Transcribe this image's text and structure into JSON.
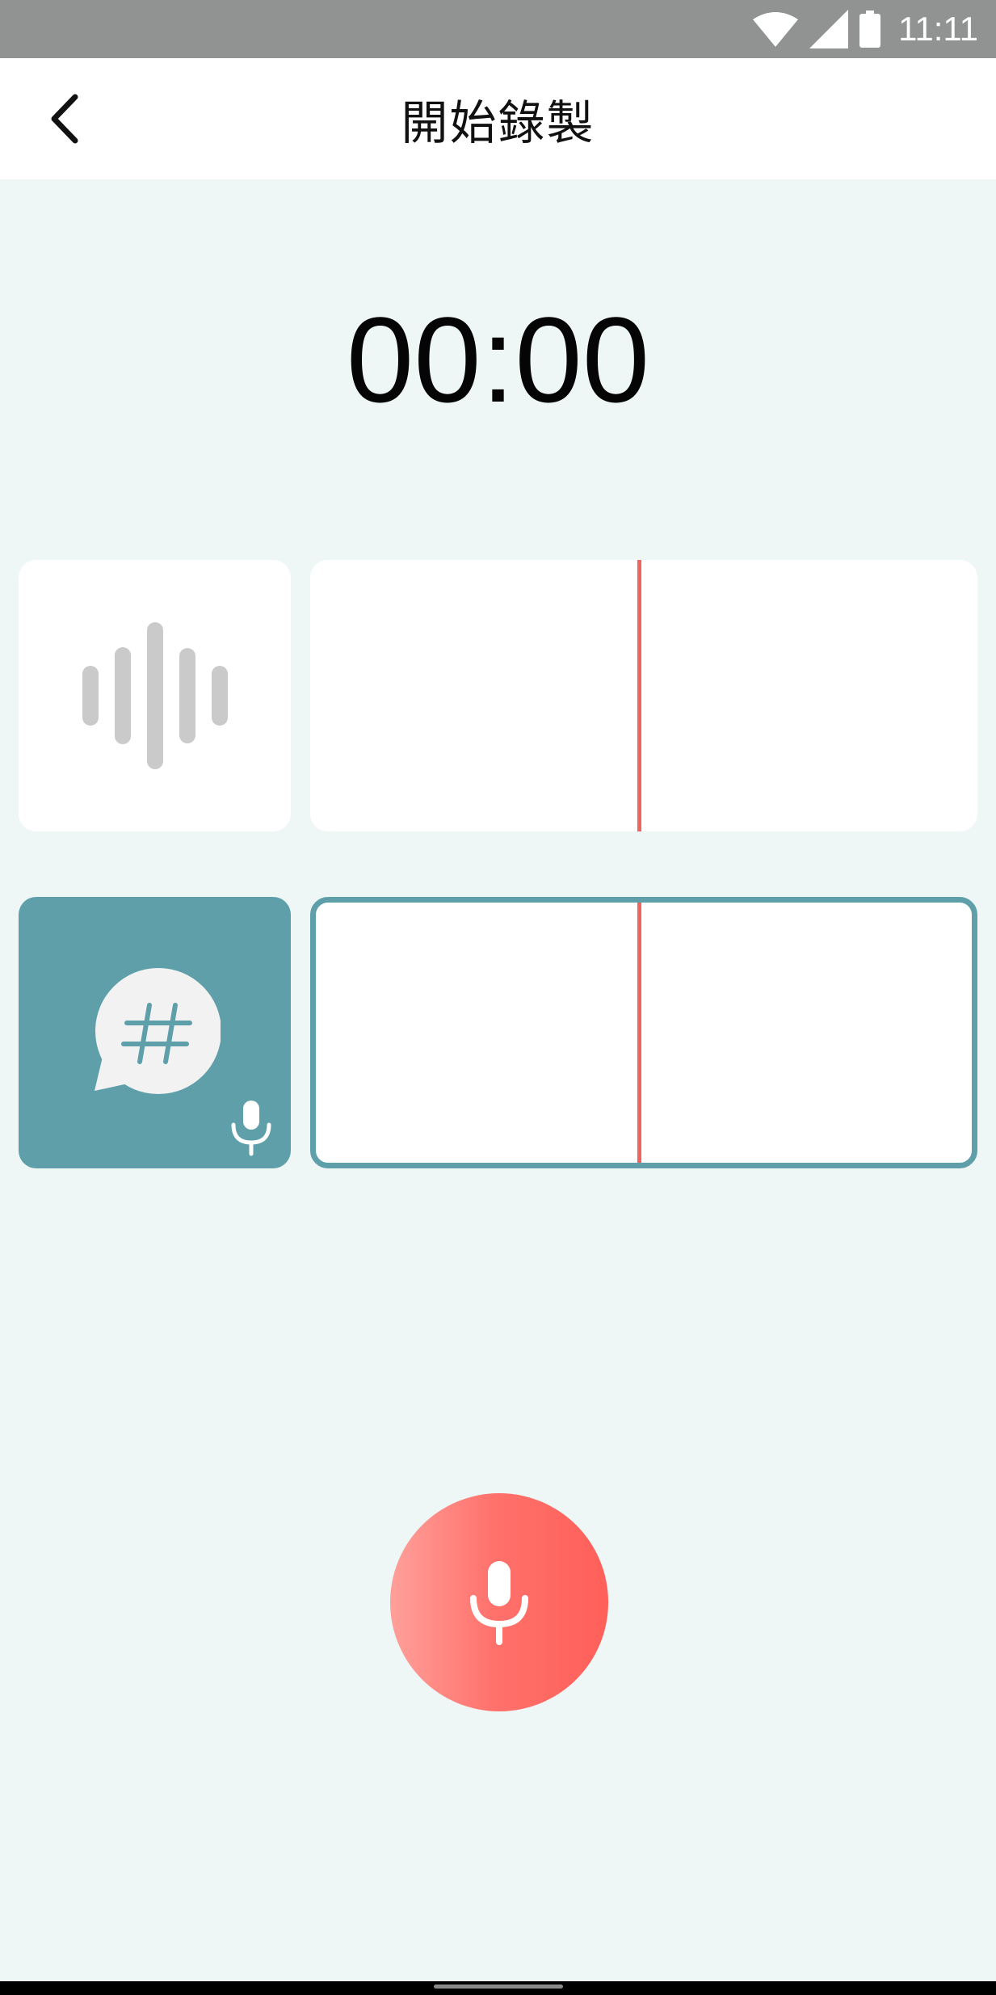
{
  "status_bar": {
    "time": "11:11",
    "icons": [
      "wifi-icon",
      "signal-icon",
      "battery-icon"
    ],
    "background": "#909392"
  },
  "app_bar": {
    "title": "開始錄製",
    "back_icon": "chevron-left-icon"
  },
  "timer": {
    "elapsed": "00:00"
  },
  "tracks": [
    {
      "id": "sound-track",
      "icon": "sound-wave-icon",
      "active": false
    },
    {
      "id": "voice-track",
      "icon": "hashtag-chat-icon",
      "badge_icon": "microphone-icon",
      "active": true
    }
  ],
  "record_button": {
    "icon": "microphone-icon"
  },
  "colors": {
    "accent": "#5f9faa",
    "record": "#ff5f59",
    "playhead": "#f0645f",
    "background": "#eff7f6"
  }
}
